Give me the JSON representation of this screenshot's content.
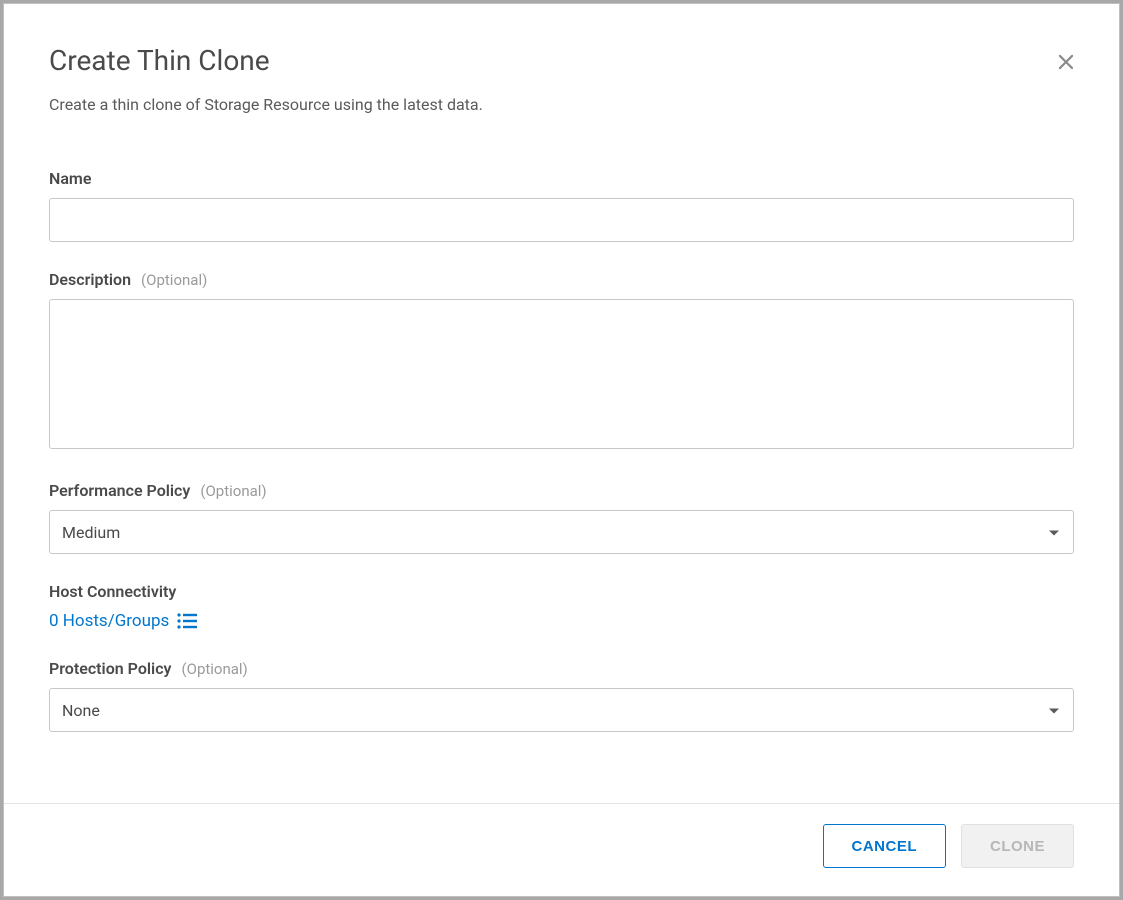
{
  "dialog": {
    "title": "Create Thin Clone",
    "subtitle": "Create a thin clone of Storage Resource using the latest data."
  },
  "form": {
    "name": {
      "label": "Name",
      "value": ""
    },
    "description": {
      "label": "Description",
      "optional": "(Optional)",
      "value": ""
    },
    "performance_policy": {
      "label": "Performance Policy",
      "optional": "(Optional)",
      "value": "Medium"
    },
    "host_connectivity": {
      "label": "Host Connectivity",
      "link_text": "0 Hosts/Groups"
    },
    "protection_policy": {
      "label": "Protection Policy",
      "optional": "(Optional)",
      "value": "None"
    }
  },
  "footer": {
    "cancel": "CANCEL",
    "clone": "CLONE"
  }
}
